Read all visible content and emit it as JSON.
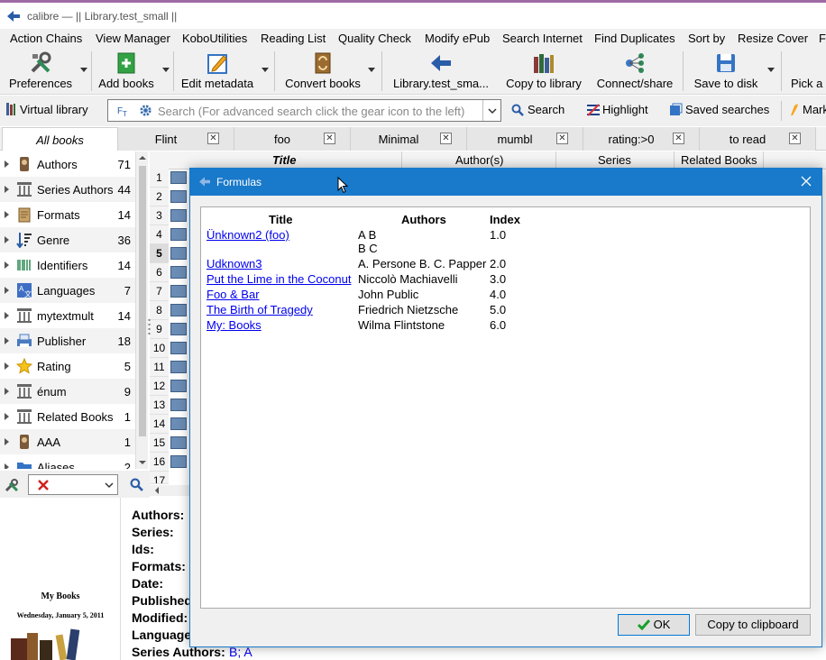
{
  "window": {
    "title": "calibre — || Library.test_small ||"
  },
  "menu": [
    "Action Chains",
    "View Manager",
    "KoboUtilities",
    "Reading List",
    "Quality Check",
    "Modify ePub",
    "Search Internet",
    "Find Duplicates",
    "Sort by",
    "Resize Cover",
    "F"
  ],
  "toolbar": {
    "preferences": "Preferences",
    "add_books": "Add books",
    "edit_metadata": "Edit metadata",
    "convert_books": "Convert books",
    "library": "Library.test_sma...",
    "copy_to_library": "Copy to library",
    "connect_share": "Connect/share",
    "save_to_disk": "Save to disk",
    "pick_a": "Pick a"
  },
  "searchbar": {
    "virtual_library": "Virtual library",
    "placeholder": "Search (For advanced search click the gear icon to the left)",
    "search": "Search",
    "highlight": "Highlight",
    "saved_searches": "Saved searches",
    "mark": "Mark"
  },
  "tabs": [
    "All books",
    "Flint",
    "foo",
    "Minimal",
    "mumbl",
    "rating:>0",
    "to read"
  ],
  "tag_browser": [
    {
      "label": "Authors",
      "count": "71",
      "icon": "authors-icon"
    },
    {
      "label": "Series Authors",
      "count": "44",
      "icon": "column-icon"
    },
    {
      "label": "Formats",
      "count": "14",
      "icon": "formats-icon"
    },
    {
      "label": "Genre",
      "count": "36",
      "icon": "genre-icon"
    },
    {
      "label": "Identifiers",
      "count": "14",
      "icon": "identifiers-icon"
    },
    {
      "label": "Languages",
      "count": "7",
      "icon": "languages-icon"
    },
    {
      "label": "mytextmult",
      "count": "14",
      "icon": "column-icon"
    },
    {
      "label": "Publisher",
      "count": "18",
      "icon": "publisher-icon"
    },
    {
      "label": "Rating",
      "count": "5",
      "icon": "star-icon"
    },
    {
      "label": "énum",
      "count": "9",
      "icon": "column-icon"
    },
    {
      "label": "Related Books",
      "count": "1",
      "icon": "column-icon"
    },
    {
      "label": "AAA",
      "count": "1",
      "icon": "authors-icon"
    },
    {
      "label": "Aliases",
      "count": "2",
      "icon": "folder-icon"
    }
  ],
  "booklist": {
    "headers": [
      "Title",
      "Author(s)",
      "Series",
      "Related Books"
    ],
    "row_numbers": [
      "1",
      "2",
      "3",
      "4",
      "5",
      "6",
      "7",
      "8",
      "9",
      "10",
      "11",
      "12",
      "13",
      "14",
      "15",
      "16",
      "17"
    ]
  },
  "details": {
    "fields": [
      "Authors:",
      "Series:",
      "Ids:",
      "Formats:",
      "Date:",
      "Published:",
      "Modified:",
      "Language:",
      "Series Authors:"
    ],
    "series_authors_value": "B; A",
    "cover_title": "My Books",
    "cover_date": "Wednesday, January 5, 2011"
  },
  "dialog": {
    "title": "Formulas",
    "columns": {
      "title": "Title",
      "authors": "Authors",
      "index": "Index"
    },
    "rows": [
      {
        "title": "Ünknown2 (foo)",
        "authors": "A B",
        "authors2": "B C",
        "index": "1.0"
      },
      {
        "title": "Udknown3",
        "authors": "A. Persone B. C. Papper",
        "index": "2.0"
      },
      {
        "title": "Put the Lime in the Coconut",
        "authors": "Niccolò Machiavelli",
        "index": "3.0"
      },
      {
        "title": "Foo & Bar",
        "authors": "John Public",
        "index": "4.0"
      },
      {
        "title": "The Birth of Tragedy",
        "authors": "Friedrich Nietzsche",
        "index": "5.0"
      },
      {
        "title": "My: Books",
        "authors": "Wilma Flintstone",
        "index": "6.0"
      }
    ],
    "ok": "OK",
    "copy": "Copy to clipboard"
  },
  "colors": {
    "accent": "#1979ca",
    "link": "#0000ee",
    "selection": "#0078d7"
  }
}
